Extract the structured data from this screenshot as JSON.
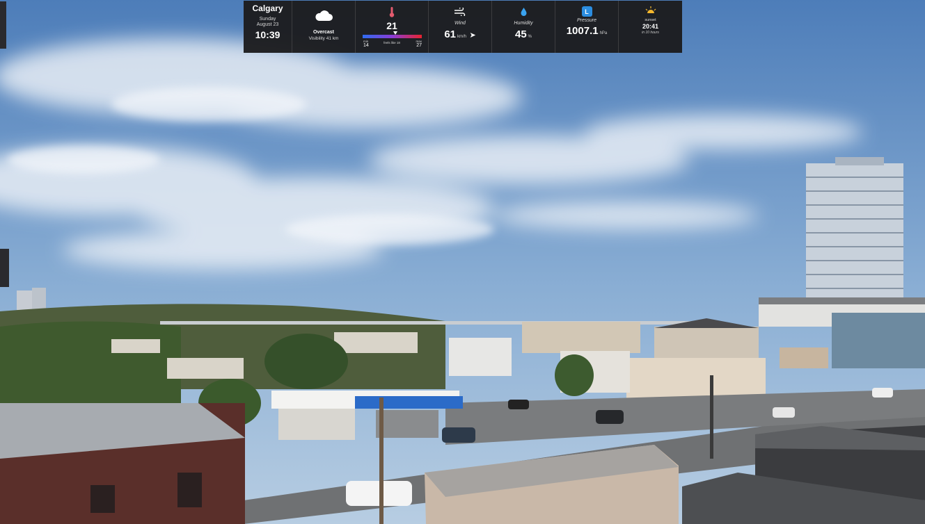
{
  "hud": {
    "location": {
      "city": "Calgary",
      "day": "Sunday",
      "date": "August 23",
      "time": "10:39"
    },
    "condition": {
      "icon": "cloud-icon",
      "label": "Overcast",
      "visibility": "Visibility 41 km"
    },
    "temperature": {
      "icon": "thermometer-icon",
      "value": "21",
      "min_label": "min",
      "min": "14",
      "feels": "feels like 18",
      "max_label": "max",
      "max": "27",
      "gradient_colors": [
        "#2f6cf0",
        "#8a3cd6",
        "#e8232f"
      ]
    },
    "wind": {
      "icon": "wind-icon",
      "label": "Wind",
      "value": "61",
      "unit": "km/h",
      "direction_icon": "arrow-right-icon"
    },
    "humidity": {
      "icon": "droplet-icon",
      "label": "Humidity",
      "value": "45",
      "unit": "%"
    },
    "pressure": {
      "icon": "pressure-badge-icon",
      "badge": "L",
      "label": "Pressure",
      "value": "1007.1",
      "unit": "hPa"
    },
    "sunset": {
      "icon": "sunset-icon",
      "label": "sunset",
      "time": "20:41",
      "relative": "in 10 hours"
    }
  },
  "scene": {
    "description_icon": "webcam-landscape",
    "colors": {
      "sky_top": "#4f7fbf",
      "sky_bottom": "#aac4de",
      "panel_bg": "#1c1c1e",
      "accent_blue": "#2b8de0",
      "sun_yellow": "#f5b82e"
    }
  }
}
